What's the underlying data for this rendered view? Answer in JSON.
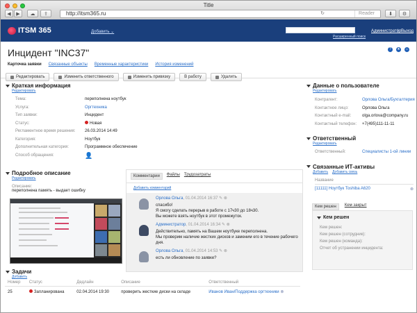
{
  "window": {
    "title": "Title",
    "url": "http://itsm365.ru",
    "reader": "Reader"
  },
  "app": {
    "logo": "ITSM 365",
    "add_menu": "Добавить ⌄",
    "advanced_search": "Расширенный поиск",
    "admin": "Администратор",
    "exit": "Выход"
  },
  "page": {
    "title": "Инцидент \"INC37\"",
    "tabs": [
      "Карточка заявки",
      "Связанные объекты",
      "Временные характеристики",
      "История изменений"
    ],
    "actions": [
      "Редактировать",
      "Изменить ответственного",
      "Изменить привязку",
      "В работу",
      "Удалить"
    ]
  },
  "brief": {
    "title": "Краткая информация",
    "edit": "Редактировать",
    "rows": [
      {
        "k": "Тема:",
        "v": "переполнена ноутбук"
      },
      {
        "k": "Услуга:",
        "v": "Оргтехника"
      },
      {
        "k": "Тип заявки:",
        "v": "Инцидент"
      },
      {
        "k": "Статус:",
        "v": "Новая"
      },
      {
        "k": "Регламентное время решения:",
        "v": "26.03.2014 14:49"
      },
      {
        "k": "Категория:",
        "v": "Ноутбук"
      },
      {
        "k": "Дополнительная категория:",
        "v": "Программное обеспечение"
      },
      {
        "k": "Способ обращения:",
        "v": ""
      }
    ]
  },
  "details": {
    "title": "Подробное описание",
    "edit": "Редактировать",
    "desc_label": "Описание:",
    "desc_text": "переполнена память - выдает ошибку"
  },
  "comments": {
    "tabs": [
      "Комментарии",
      "Файлы",
      "Трудозатраты"
    ],
    "add": "Добавить комментарий",
    "items": [
      {
        "author": "Орлова Ольга",
        "date": "01.04.2014 16:37",
        "lines": [
          "спасибо!",
          "Я смогу сделать перерыв в работе с 17ч30 до 18ч30.",
          "Вы можете взять ноутбук в этот промежуток."
        ]
      },
      {
        "author": "Администратор",
        "date": "01.04.2014 16:34",
        "lines": [
          "Действительно, память на Вашем ноутбуке переполнена.",
          "Мы проверим наличие жестких дисков и заменим его в течение рабочего дня."
        ]
      },
      {
        "author": "Орлова Ольга",
        "date": "01.04.2014 14:53",
        "lines": [
          "есть ли обновление по заявке?"
        ]
      }
    ]
  },
  "tasks": {
    "title": "Задачи",
    "add": "Добавить",
    "headers": [
      "Номер",
      "Статус",
      "Дедлайн",
      "Описание",
      "Ответственный"
    ],
    "rows": [
      {
        "num": "25",
        "status": "Запланирована",
        "deadline": "02.04.2014 19:30",
        "desc": "проверить жесткие диски на складе",
        "resp": "Иванов Иван/Поддержка оргтехники"
      }
    ]
  },
  "user_data": {
    "title": "Данные о пользователе",
    "edit": "Редактировать",
    "rows": [
      {
        "k": "Контрагент:",
        "v": "Орлова Ольга/Бухгалтерия"
      },
      {
        "k": "Контактное лицо:",
        "v": "Орлова Ольга"
      },
      {
        "k": "Контактный e-mail:",
        "v": "olga.orlova@company.ru"
      },
      {
        "k": "Контактный телефон:",
        "v": "+7(495)111-11-11"
      }
    ]
  },
  "responsible": {
    "title": "Ответственный",
    "edit": "Редактировать",
    "label": "Ответственный:",
    "value": "Специалисты 1-ой линии"
  },
  "assets": {
    "title": "Связанные ИТ-активы",
    "add": "Добавить",
    "add_link": "Добавить связь",
    "name_label": "Название",
    "item": "[11111] Ноутбук Toshiba A620",
    "tabs": [
      "Кем решен",
      "Кем закрыт"
    ],
    "solved_title": "Кем решен",
    "solved_rows": [
      "Кем решен:",
      "Кем решен (сотрудник):",
      "Кем решен (команда):",
      "Отчет об устранении инцидента:"
    ]
  }
}
